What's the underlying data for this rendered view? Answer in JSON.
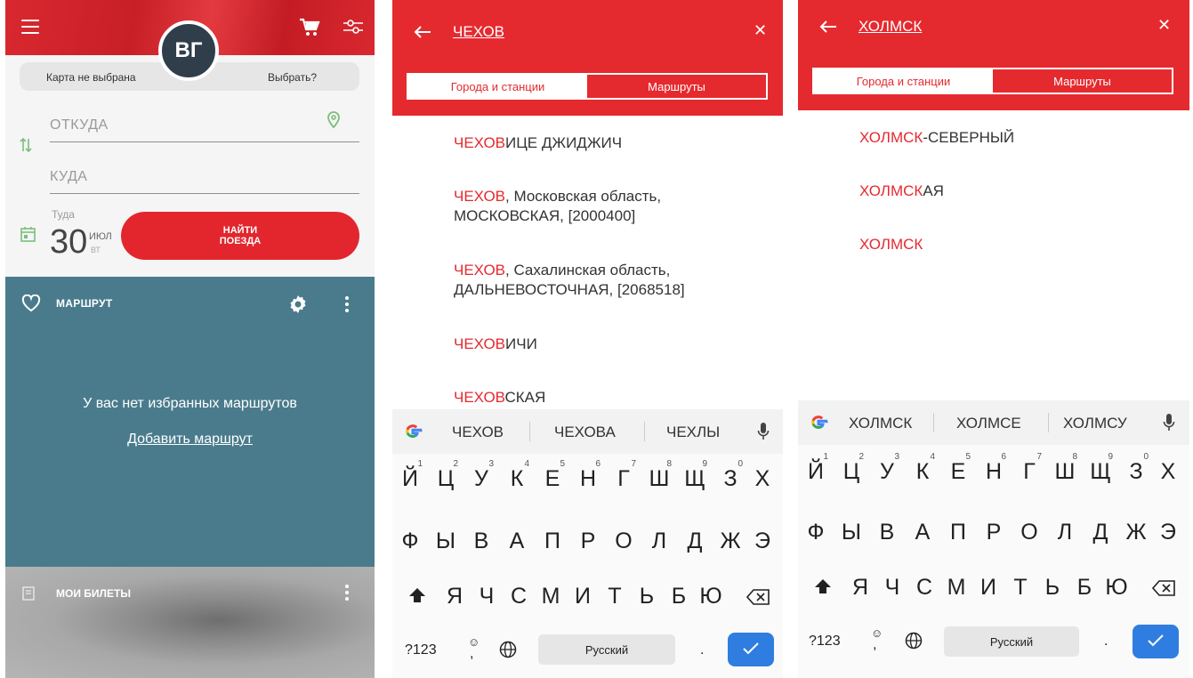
{
  "colors": {
    "accent": "#e52a2f",
    "teal_panel": "#4a7b8c",
    "avatar_bg": "#2f3e4a",
    "enter_key": "#2f7de1"
  },
  "main": {
    "header": {
      "menu_icon": "menu-icon",
      "cart_icon": "cart-icon",
      "filter_icon": "filter-icon"
    },
    "avatar": "ВГ",
    "card": {
      "label": "Карта не выбрана",
      "pick": "Выбрать?"
    },
    "from_placeholder": "ОТКУДА",
    "to_placeholder": "КУДА",
    "date": {
      "label": "Туда",
      "day": "30",
      "month": "ИЮЛ",
      "weekday": "ВТ"
    },
    "find_button": {
      "line1": "НАЙТИ",
      "line2": "ПОЕЗДА"
    },
    "favorites": {
      "title": "МАРШРУТ",
      "empty": "У вас нет избранных маршрутов",
      "add": "Добавить маршрут"
    },
    "tickets": {
      "title": "МОИ БИЛЕТЫ"
    }
  },
  "search1": {
    "query": "ЧЕХОВ",
    "tabs": [
      "Города и станции",
      "Маршруты"
    ],
    "results": [
      {
        "hl": "ЧЕХОВ",
        "rest": "ИЦЕ ДЖИДЖИЧ",
        "line2": ""
      },
      {
        "hl": "ЧЕХОВ",
        "rest": ", Московская область,",
        "line2": "МОСКОВСКАЯ, [2000400]"
      },
      {
        "hl": "ЧЕХОВ",
        "rest": ", Сахалинская область,",
        "line2": "ДАЛЬНЕВОСТОЧНАЯ, [2068518]"
      },
      {
        "hl": "ЧЕХОВ",
        "rest": "ИЧИ",
        "line2": ""
      },
      {
        "hl": "ЧЕХОВ",
        "rest": "СКАЯ",
        "line2": ""
      }
    ],
    "suggestions": [
      "ЧЕХОВ",
      "ЧЕХОВА",
      "ЧЕХЛЫ"
    ]
  },
  "search2": {
    "query": "ХОЛМСК",
    "tabs": [
      "Города и станции",
      "Маршруты"
    ],
    "results": [
      {
        "hl": "ХОЛМСК",
        "rest": "-СЕВЕРНЫЙ"
      },
      {
        "hl": "ХОЛМСК",
        "rest": "АЯ"
      },
      {
        "hl": "ХОЛМСК",
        "rest": ""
      }
    ],
    "suggestions": [
      "ХОЛМСК",
      "ХОЛМСЕ",
      "ХОЛМСУ"
    ]
  },
  "keyboard": {
    "row1": [
      "Й",
      "Ц",
      "У",
      "К",
      "Е",
      "Н",
      "Г",
      "Ш",
      "Щ",
      "З",
      "Х"
    ],
    "row1_hints": [
      "1",
      "2",
      "3",
      "4",
      "5",
      "6",
      "7",
      "8",
      "9",
      "0",
      ""
    ],
    "row2": [
      "Ф",
      "Ы",
      "В",
      "А",
      "П",
      "Р",
      "О",
      "Л",
      "Д",
      "Ж",
      "Э"
    ],
    "row3": [
      "Я",
      "Ч",
      "С",
      "М",
      "И",
      "Т",
      "Ь",
      "Б",
      "Ю"
    ],
    "symbols": "?123",
    "comma": ",",
    "period": ".",
    "space_label": "Русский"
  }
}
